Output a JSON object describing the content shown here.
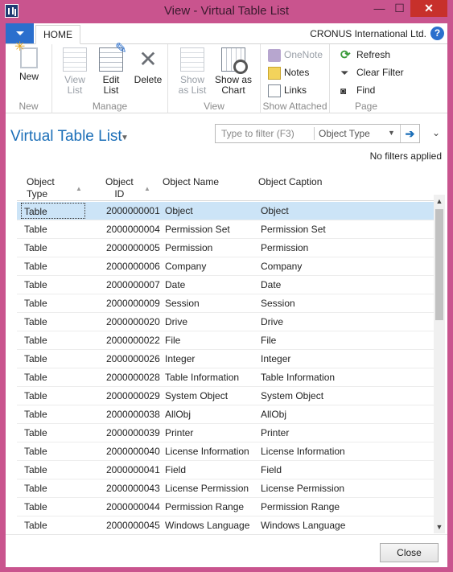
{
  "window": {
    "title": "View - Virtual Table List",
    "minimize": "—",
    "maximize": "☐",
    "close": "✕"
  },
  "ribbon": {
    "tab_home": "HOME",
    "company": "CRONUS International Ltd.",
    "help": "?",
    "groups": {
      "new": {
        "label": "New",
        "new_btn": "New"
      },
      "manage": {
        "label": "Manage",
        "view_list": "View\nList",
        "edit_list": "Edit\nList",
        "delete": "Delete"
      },
      "view": {
        "label": "View",
        "show_as_list": "Show\nas List",
        "show_as_chart": "Show as\nChart"
      },
      "show_attached": {
        "label": "Show Attached",
        "onenote": "OneNote",
        "notes": "Notes",
        "links": "Links"
      },
      "page": {
        "label": "Page",
        "refresh": "Refresh",
        "clear_filter": "Clear Filter",
        "find": "Find"
      }
    }
  },
  "page": {
    "title": "Virtual Table List",
    "filter_placeholder": "Type to filter (F3)",
    "filter_field": "Object Type",
    "filter_status": "No filters applied"
  },
  "table": {
    "headers": {
      "object_type": "Object\nType",
      "object_id": "Object\nID",
      "object_name": "Object Name",
      "object_caption": "Object Caption"
    },
    "rows": [
      {
        "type": "Table",
        "id": "2000000001",
        "name": "Object",
        "caption": "Object"
      },
      {
        "type": "Table",
        "id": "2000000004",
        "name": "Permission Set",
        "caption": "Permission Set"
      },
      {
        "type": "Table",
        "id": "2000000005",
        "name": "Permission",
        "caption": "Permission"
      },
      {
        "type": "Table",
        "id": "2000000006",
        "name": "Company",
        "caption": "Company"
      },
      {
        "type": "Table",
        "id": "2000000007",
        "name": "Date",
        "caption": "Date"
      },
      {
        "type": "Table",
        "id": "2000000009",
        "name": "Session",
        "caption": "Session"
      },
      {
        "type": "Table",
        "id": "2000000020",
        "name": "Drive",
        "caption": "Drive"
      },
      {
        "type": "Table",
        "id": "2000000022",
        "name": "File",
        "caption": "File"
      },
      {
        "type": "Table",
        "id": "2000000026",
        "name": "Integer",
        "caption": "Integer"
      },
      {
        "type": "Table",
        "id": "2000000028",
        "name": "Table Information",
        "caption": "Table Information"
      },
      {
        "type": "Table",
        "id": "2000000029",
        "name": "System Object",
        "caption": "System Object"
      },
      {
        "type": "Table",
        "id": "2000000038",
        "name": "AllObj",
        "caption": "AllObj"
      },
      {
        "type": "Table",
        "id": "2000000039",
        "name": "Printer",
        "caption": "Printer"
      },
      {
        "type": "Table",
        "id": "2000000040",
        "name": "License Information",
        "caption": "License Information"
      },
      {
        "type": "Table",
        "id": "2000000041",
        "name": "Field",
        "caption": "Field"
      },
      {
        "type": "Table",
        "id": "2000000043",
        "name": "License Permission",
        "caption": "License Permission"
      },
      {
        "type": "Table",
        "id": "2000000044",
        "name": "Permission Range",
        "caption": "Permission Range"
      },
      {
        "type": "Table",
        "id": "2000000045",
        "name": "Windows Language",
        "caption": "Windows Language"
      }
    ]
  },
  "footer": {
    "close": "Close"
  }
}
